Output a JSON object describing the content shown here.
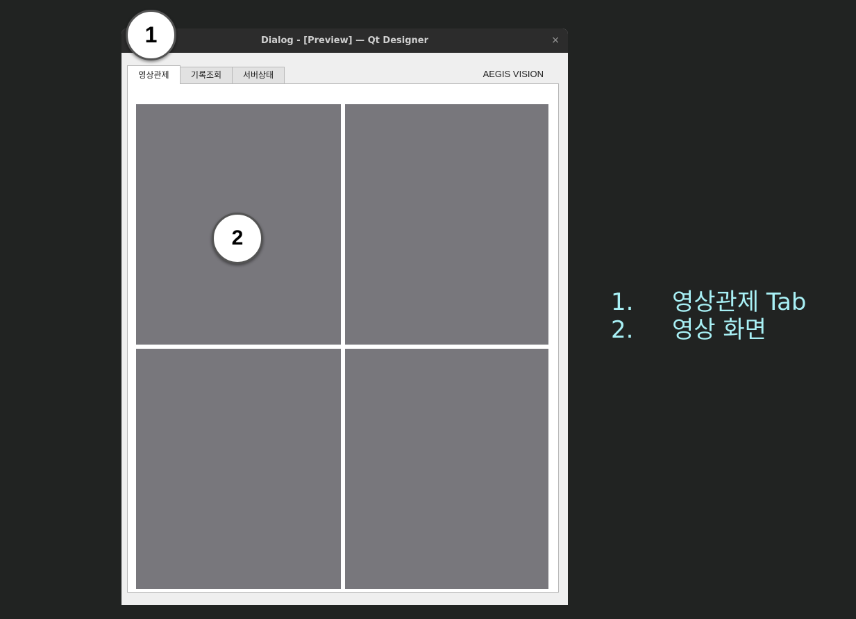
{
  "window": {
    "title": "Dialog - [Preview] — Qt Designer",
    "close_glyph": "×"
  },
  "tabs": [
    {
      "label": "영상관제",
      "active": true
    },
    {
      "label": "기록조회",
      "active": false
    },
    {
      "label": "서버상태",
      "active": false
    }
  ],
  "brand": "AEGIS VISION",
  "video_panels": [
    "",
    "",
    "",
    ""
  ],
  "markers": [
    "1",
    "2"
  ],
  "legend": [
    {
      "num": "1.",
      "text": "영상관제 Tab"
    },
    {
      "num": "2.",
      "text": "영상 화면"
    }
  ],
  "colors": {
    "background": "#212322",
    "titlebar": "#2c2c2c",
    "video_panel": "#78777c",
    "legend_text": "#a8f0f5"
  }
}
